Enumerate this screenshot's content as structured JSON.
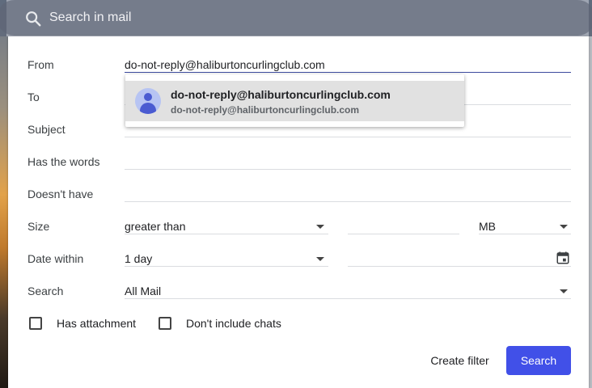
{
  "search": {
    "placeholder": "Search in mail"
  },
  "form": {
    "from": {
      "label": "From",
      "value": "do-not-reply@haliburtoncurlingclub.com"
    },
    "to": {
      "label": "To",
      "value": ""
    },
    "subject": {
      "label": "Subject",
      "value": ""
    },
    "has_words": {
      "label": "Has the words",
      "value": ""
    },
    "doesnt_have": {
      "label": "Doesn't have",
      "value": ""
    },
    "size": {
      "label": "Size",
      "operator": "greater than",
      "value": "",
      "unit": "MB"
    },
    "date_within": {
      "label": "Date within",
      "value": "1 day",
      "date": ""
    },
    "search_in": {
      "label": "Search",
      "value": "All Mail"
    },
    "has_attachment": {
      "label": "Has attachment",
      "checked": false
    },
    "no_chats": {
      "label": "Don't include chats",
      "checked": false
    }
  },
  "autocomplete": {
    "name": "do-not-reply@haliburtoncurlingclub.com",
    "email": "do-not-reply@haliburtoncurlingclub.com"
  },
  "actions": {
    "create_filter": "Create filter",
    "search": "Search"
  },
  "colors": {
    "primary": "#4150e8",
    "active_underline": "#3c4a9e",
    "avatar": "#4a5bd1"
  }
}
